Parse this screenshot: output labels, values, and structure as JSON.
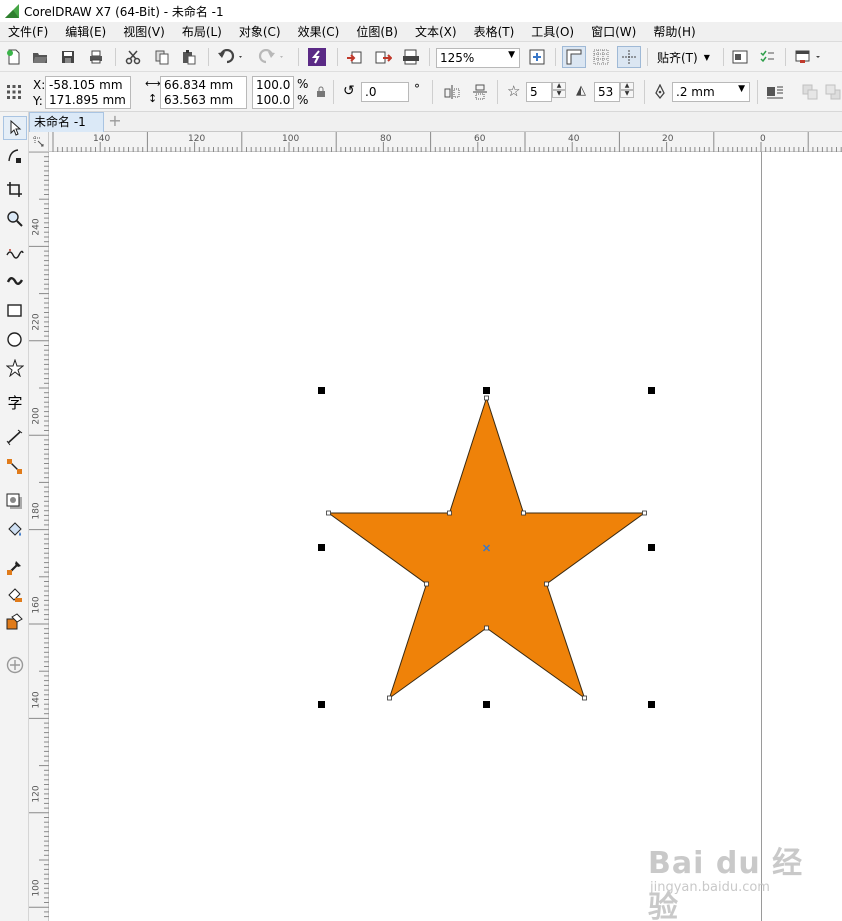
{
  "window": {
    "title": "CorelDRAW X7 (64-Bit) - 未命名 -1"
  },
  "menu": [
    "文件(F)",
    "编辑(E)",
    "视图(V)",
    "布局(L)",
    "对象(C)",
    "效果(C)",
    "位图(B)",
    "文本(X)",
    "表格(T)",
    "工具(O)",
    "窗口(W)",
    "帮助(H)"
  ],
  "toolbar": {
    "zoom": "125%",
    "snap_label": "贴齐(T)"
  },
  "property_bar": {
    "x_label": "X:",
    "x_value": "-58.105 mm",
    "y_label": "Y:",
    "y_value": "171.895 mm",
    "width_value": "66.834 mm",
    "height_value": "63.563 mm",
    "scale_x": "100.0",
    "scale_y": "100.0",
    "percent": "%",
    "rotation": ".0",
    "degree": "°",
    "points": "5",
    "sharpness": "53",
    "outline_width": ".2 mm"
  },
  "document": {
    "tab_label": "未命名 -1",
    "add_tab": "+"
  },
  "rulers": {
    "horizontal": [
      "140",
      "120",
      "100",
      "80",
      "60",
      "40",
      "20",
      "0"
    ],
    "vertical": [
      "240",
      "220",
      "200",
      "180",
      "160",
      "140",
      "120",
      "100"
    ]
  },
  "star": {
    "fill": "#ef8209",
    "stroke": "#3a2a12",
    "points": 5
  },
  "colors": {
    "accent_blue": "#3a78c8",
    "menu_bg": "#f0f0f0"
  },
  "watermark": {
    "brand": "Bai du 经验",
    "url": "jingyan.baidu.com"
  }
}
